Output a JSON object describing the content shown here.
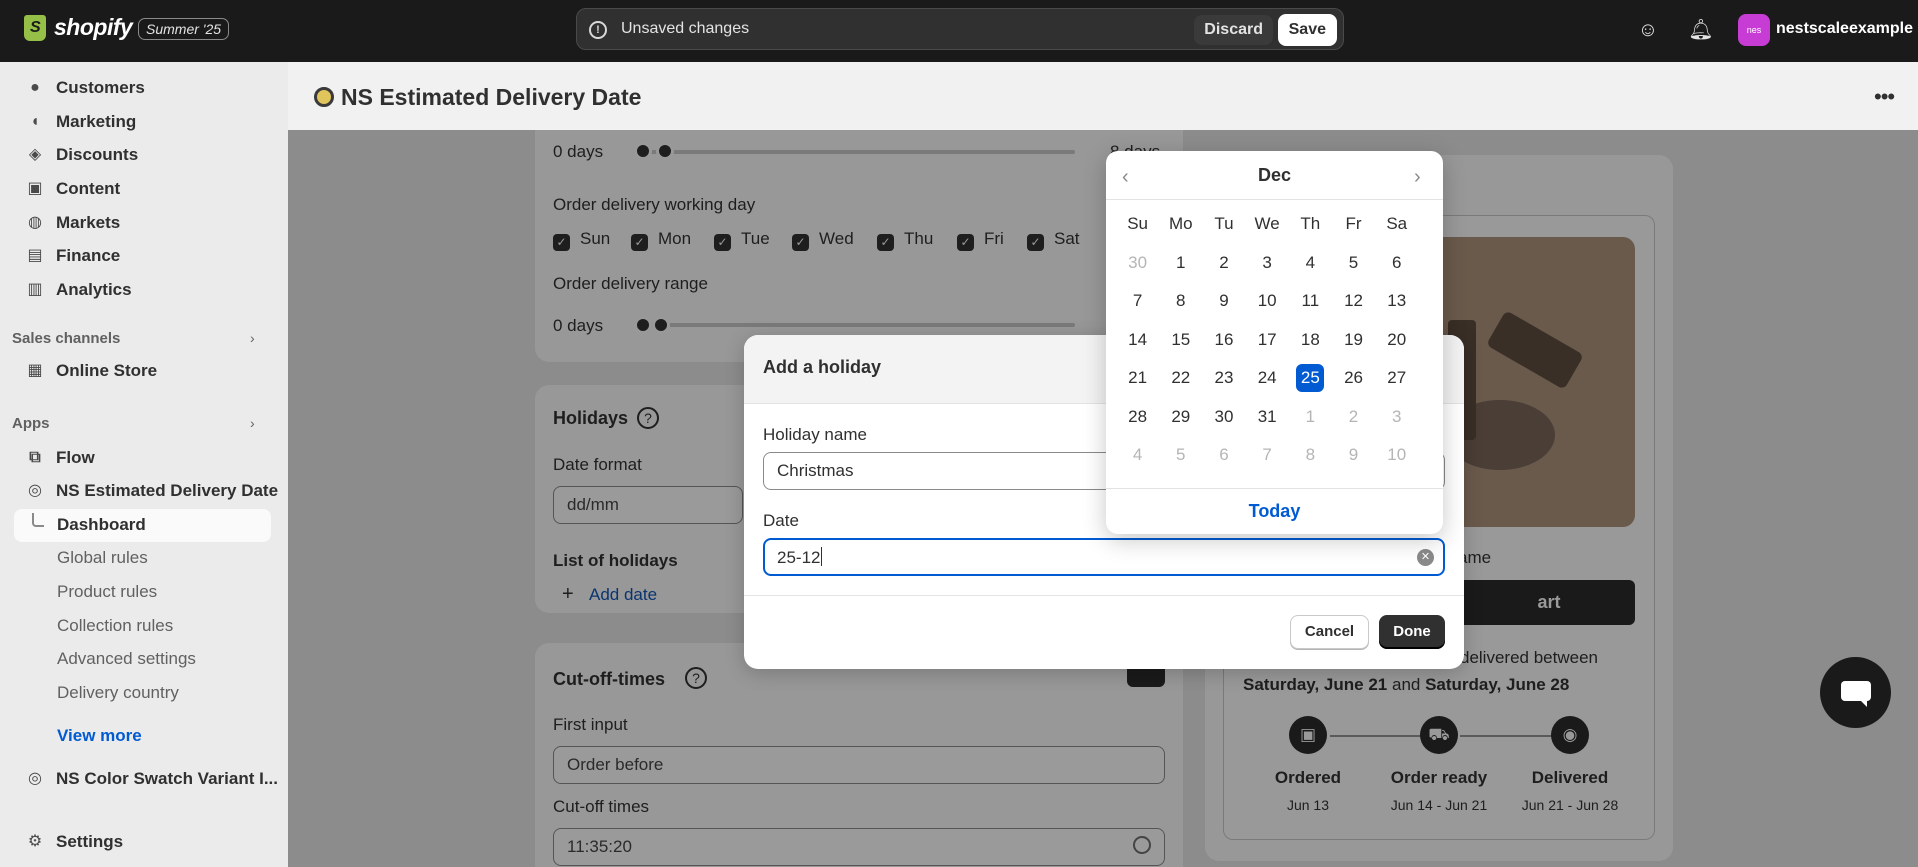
{
  "topbar": {
    "logo_text": "shopify",
    "edition_badge": "Summer '25",
    "unsaved_label": "Unsaved changes",
    "discard_label": "Discard",
    "save_label": "Save",
    "avatar_initials": "nes",
    "store_name": "nestscaleexample"
  },
  "sidebar": {
    "items": [
      {
        "label": "Customers",
        "icon": "person-icon"
      },
      {
        "label": "Marketing",
        "icon": "megaphone-icon"
      },
      {
        "label": "Discounts",
        "icon": "discount-icon"
      },
      {
        "label": "Content",
        "icon": "content-icon"
      },
      {
        "label": "Markets",
        "icon": "globe-icon"
      },
      {
        "label": "Finance",
        "icon": "bank-icon"
      },
      {
        "label": "Analytics",
        "icon": "chart-icon"
      }
    ],
    "sales_channels_label": "Sales channels",
    "online_store_label": "Online Store",
    "apps_label": "Apps",
    "flow_label": "Flow",
    "app_name": "NS Estimated Delivery Date",
    "app_sub_items": [
      "Dashboard",
      "Global rules",
      "Product rules",
      "Collection rules",
      "Advanced settings",
      "Delivery country"
    ],
    "view_more_label": "View more",
    "color_swatch_app": "NS Color Swatch Variant I...",
    "settings_label": "Settings"
  },
  "header": {
    "title": "NS Estimated Delivery Date"
  },
  "background": {
    "range_start_1": "0 days",
    "range_end_1": "8 days",
    "working_day_label": "Order delivery working day",
    "weekdays": [
      "Sun",
      "Mon",
      "Tue",
      "Wed",
      "Thu",
      "Fri",
      "Sat"
    ],
    "range_label": "Order delivery range",
    "range_start_2": "0 days",
    "holidays_title": "Holidays",
    "date_format_label": "Date format",
    "date_format_value": "dd/mm",
    "list_holidays_label": "List of holidays",
    "add_date_label": "Add date",
    "cutoff_title": "Cut-off-times",
    "first_input_label": "First input",
    "first_input_value": "Order before",
    "cutoff_times_label": "Cut-off times",
    "cutoff_times_value": "11:35:20",
    "preview_name_partial": "ame",
    "add_to_cart_partial": "art",
    "delivered_between_partial": "delivered between",
    "date_range_start": "Saturday, June 21",
    "date_range_and": "and",
    "date_range_end": "Saturday, June 28",
    "steps": [
      {
        "label": "Ordered",
        "date": "Jun 13",
        "icon": "clipboard-icon"
      },
      {
        "label": "Order ready",
        "date": "Jun 14 - Jun 21",
        "icon": "truck-icon"
      },
      {
        "label": "Delivered",
        "date": "Jun 21 - Jun 28",
        "icon": "map-pin-icon"
      }
    ]
  },
  "modal": {
    "title": "Add a holiday",
    "holiday_name_label": "Holiday name",
    "holiday_name_value": "Christmas",
    "date_label": "Date",
    "date_value": "25-12",
    "cancel_label": "Cancel",
    "done_label": "Done"
  },
  "picker": {
    "month": "Dec",
    "weekday_headers": [
      "Su",
      "Mo",
      "Tu",
      "We",
      "Th",
      "Fr",
      "Sa"
    ],
    "days": [
      [
        "30",
        "1",
        "2",
        "3",
        "4",
        "5",
        "6"
      ],
      [
        "7",
        "8",
        "9",
        "10",
        "11",
        "12",
        "13"
      ],
      [
        "14",
        "15",
        "16",
        "17",
        "18",
        "19",
        "20"
      ],
      [
        "21",
        "22",
        "23",
        "24",
        "25",
        "26",
        "27"
      ],
      [
        "28",
        "29",
        "30",
        "31",
        "1",
        "2",
        "3"
      ],
      [
        "4",
        "5",
        "6",
        "7",
        "8",
        "9",
        "10"
      ]
    ],
    "selected_day": "25",
    "today_label": "Today"
  },
  "colors": {
    "accent": "#005bd3",
    "topbar": "#1a1a1a",
    "primary_button": "#303030"
  }
}
